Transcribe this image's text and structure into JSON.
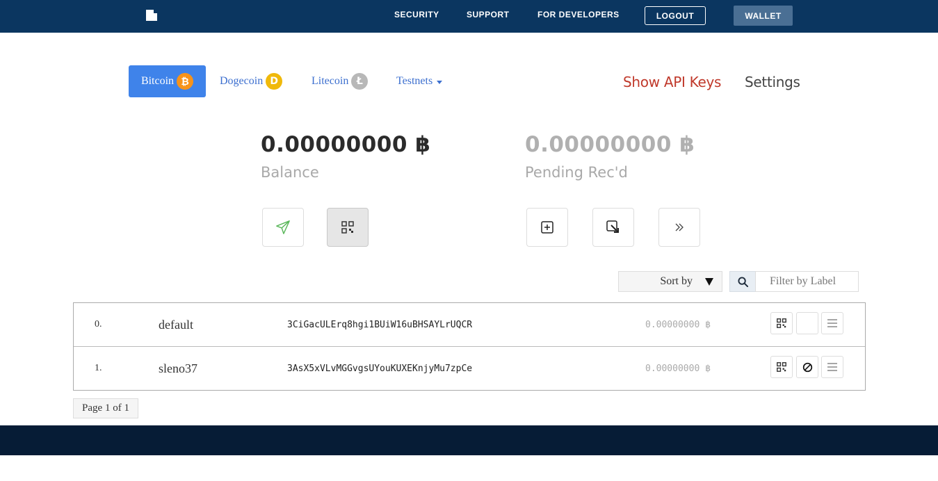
{
  "nav": {
    "links": [
      "SECURITY",
      "SUPPORT",
      "FOR DEVELOPERS"
    ],
    "logout": "LOGOUT",
    "wallet": "WALLET"
  },
  "coins": {
    "tabs": [
      {
        "label": "Bitcoin",
        "icon": "bitcoin-icon",
        "symbol": "₿",
        "color": "#f7931a",
        "active": true
      },
      {
        "label": "Dogecoin",
        "icon": "dogecoin-icon",
        "symbol": "D",
        "color": "#f0b90b"
      },
      {
        "label": "Litecoin",
        "icon": "litecoin-icon",
        "symbol": "Ł",
        "color": "#b8b8b8"
      },
      {
        "label": "Testnets",
        "dropdown": true
      }
    ],
    "active_color": "#3f83ea"
  },
  "header_links": {
    "api_keys": "Show API Keys",
    "settings": "Settings"
  },
  "balances": {
    "balance": "0.00000000 ฿",
    "balance_label": "Balance",
    "pending": "0.00000000 ฿",
    "pending_label": "Pending Rec'd"
  },
  "actions": [
    {
      "name": "send-icon",
      "pressed": false
    },
    {
      "name": "qr-code-icon",
      "pressed": true
    },
    {
      "name": "add-address-icon",
      "pressed": false
    },
    {
      "name": "sweep-icon",
      "pressed": false
    },
    {
      "name": "double-chevron-right-icon",
      "pressed": false
    }
  ],
  "toolbar": {
    "sort_label": "Sort by",
    "filter_placeholder": "Filter by Label"
  },
  "addresses": [
    {
      "index": "0.",
      "label": "default",
      "address": "3CiGacULErq8hgi1BUiW16uBHSAYLrUQCR",
      "balance": "0.00000000 ฿"
    },
    {
      "index": "1.",
      "label": "sleno37",
      "address": "3AsX5xVLvMGGvgsUYouKUXEKnjyMu7zpCe",
      "balance": "0.00000000 ฿"
    }
  ],
  "pagination": {
    "label": "Page 1 of 1"
  },
  "colors": {
    "navbar": "#0b3660",
    "footer": "#061c36",
    "api_keys": "#c0392b"
  }
}
